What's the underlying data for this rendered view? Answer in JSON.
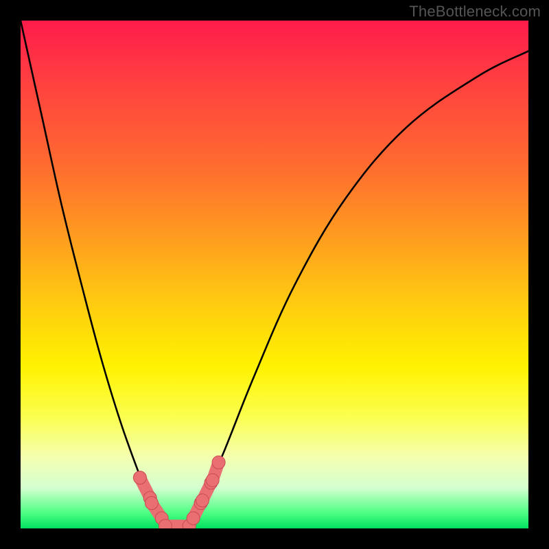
{
  "watermark": "TheBottleneck.com",
  "chart_data": {
    "type": "line",
    "title": "",
    "xlabel": "",
    "ylabel": "",
    "xlim": [
      0,
      100
    ],
    "ylim": [
      0,
      100
    ],
    "notes": "Gradient background from red (top, high bottleneck) through orange/yellow to green (bottom, optimal). Black curve dips to minimum near x≈28–32 where it touches the green band; pink capsule markers highlight the near-optimal region on both sides of the trough.",
    "series": [
      {
        "name": "bottleneck-curve",
        "color": "#000000",
        "x": [
          0,
          4,
          8,
          12,
          16,
          20,
          24,
          26,
          28,
          30,
          32,
          34,
          36,
          40,
          46,
          54,
          64,
          76,
          90,
          100
        ],
        "values": [
          100,
          82,
          64,
          48,
          33,
          20,
          9,
          4,
          1,
          0,
          0.5,
          2,
          6,
          15,
          30,
          48,
          65,
          79,
          89,
          94
        ]
      }
    ],
    "markers": {
      "color": "#e96f73",
      "stroke": "#c94a50",
      "radius_px": 9,
      "segments": [
        {
          "side": "left",
          "x_range": [
            23.5,
            25.5
          ],
          "y_range": [
            10,
            6
          ]
        },
        {
          "side": "left",
          "x_range": [
            25.8,
            27.8
          ],
          "y_range": [
            5,
            2
          ]
        },
        {
          "side": "floor",
          "x_range": [
            28.5,
            33.2
          ],
          "y_range": [
            0.5,
            0.5
          ]
        },
        {
          "side": "right",
          "x_range": [
            34.0,
            35.5
          ],
          "y_range": [
            2,
            5
          ]
        },
        {
          "side": "right",
          "x_range": [
            35.8,
            37.5
          ],
          "y_range": [
            5.5,
            9
          ]
        },
        {
          "side": "right",
          "x_range": [
            37.8,
            39.0
          ],
          "y_range": [
            9.5,
            13
          ]
        }
      ]
    },
    "gradient_stops": [
      {
        "pos": 0.0,
        "color": "#ff1b4b"
      },
      {
        "pos": 0.12,
        "color": "#ff4040"
      },
      {
        "pos": 0.28,
        "color": "#ff6a30"
      },
      {
        "pos": 0.42,
        "color": "#ff9a20"
      },
      {
        "pos": 0.55,
        "color": "#ffc911"
      },
      {
        "pos": 0.68,
        "color": "#fff200"
      },
      {
        "pos": 0.78,
        "color": "#fbff4f"
      },
      {
        "pos": 0.86,
        "color": "#f4ffb0"
      },
      {
        "pos": 0.92,
        "color": "#d4ffd0"
      },
      {
        "pos": 0.97,
        "color": "#4cff82"
      },
      {
        "pos": 1.0,
        "color": "#00e060"
      }
    ]
  }
}
